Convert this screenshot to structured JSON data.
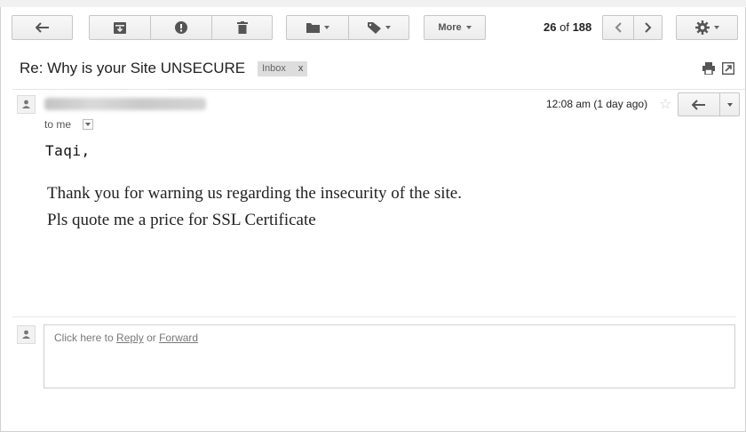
{
  "toolbar": {
    "more_label": "More",
    "pagination": {
      "current": "26",
      "of_label": "of",
      "total": "188"
    }
  },
  "subject": {
    "text": "Re: Why is your Site UNSECURE",
    "label": "Inbox",
    "label_close": "x"
  },
  "message": {
    "time": "12:08 am (1 day ago)",
    "to_label": "to me",
    "greeting": "Taqi,",
    "body_lines": [
      "Thank you for warning us regarding the insecurity of the site.",
      "Pls quote me a price for SSL Certificate"
    ]
  },
  "reply_prompt": {
    "prefix": "Click here to",
    "reply_link": "Reply",
    "or_label": "or",
    "forward_link": "Forward"
  },
  "icons": [
    "back-arrow-icon",
    "archive-icon",
    "report-spam-icon",
    "delete-icon",
    "folder-icon",
    "tag-icon",
    "chevron-left-icon",
    "chevron-right-icon",
    "gear-icon",
    "print-icon",
    "new-window-icon",
    "person-icon",
    "star-icon",
    "reply-icon",
    "chevron-down-icon"
  ],
  "colors": {
    "button_border": "#c6c6c6",
    "label_chip_bg": "#dddddd",
    "divider": "#e5e5e5"
  }
}
